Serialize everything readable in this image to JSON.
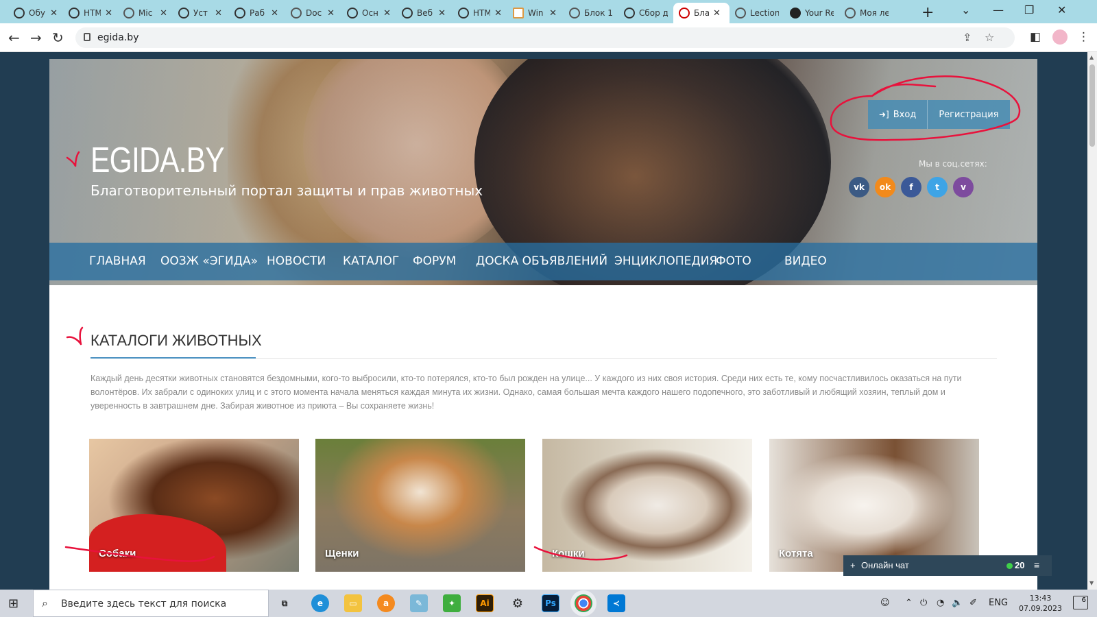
{
  "browser": {
    "tabs": [
      {
        "title": "Обу",
        "icon": "openai-icon"
      },
      {
        "title": "HTM",
        "icon": "openai-icon"
      },
      {
        "title": "Mic",
        "icon": "globe-icon"
      },
      {
        "title": "Уст",
        "icon": "openai-icon"
      },
      {
        "title": "Раб",
        "icon": "openai-icon"
      },
      {
        "title": "Doc",
        "icon": "globe-icon"
      },
      {
        "title": "Осн",
        "icon": "openai-icon"
      },
      {
        "title": "Веб",
        "icon": "openai-icon"
      },
      {
        "title": "HTM",
        "icon": "openai-icon"
      },
      {
        "title": "Win",
        "icon": "doc-icon"
      },
      {
        "title": "Блок 1.",
        "icon": "globe-icon"
      },
      {
        "title": "Сбор д",
        "icon": "openai-icon"
      },
      {
        "title": "Благ",
        "icon": "paw-icon",
        "active": true
      },
      {
        "title": "Lection",
        "icon": "globe-icon"
      },
      {
        "title": "Your Re",
        "icon": "github-icon"
      },
      {
        "title": "Моя ле",
        "icon": "globe-icon"
      }
    ],
    "url": "egida.by"
  },
  "site": {
    "logo": "EGIDA.BY",
    "tagline": "Благотворительный портал защиты и прав животных",
    "auth": {
      "login": "Вход",
      "register": "Регистрация"
    },
    "social_label": "Мы в соц.сетях:",
    "social": [
      {
        "name": "vk",
        "glyph": "vk",
        "color": "#3b5a84"
      },
      {
        "name": "odnoklassniki",
        "glyph": "ok",
        "color": "#f28a1b"
      },
      {
        "name": "facebook",
        "glyph": "f",
        "color": "#3b5998"
      },
      {
        "name": "twitter",
        "glyph": "t",
        "color": "#3ea4e6"
      },
      {
        "name": "viber",
        "glyph": "v",
        "color": "#7d4b9e"
      }
    ],
    "nav": [
      "ГЛАВНАЯ",
      "ООЗЖ «ЭГИДА»",
      "НОВОСТИ",
      "КАТАЛОГ",
      "ФОРУМ",
      "ДОСКА ОБЪЯВЛЕНИЙ",
      "ЭНЦИКЛОПЕДИЯ",
      "ФОТО",
      "ВИДЕО"
    ],
    "section_title": "КАТАЛОГИ ЖИВОТНЫХ",
    "intro": "Каждый день десятки животных становятся бездомными, кого-то выбросили, кто-то потерялся, кто-то был рожден на улице... У каждого из них своя история. Среди них есть те, кому посчастливилось оказаться на пути волонтёров. Их забрали с одиноких улиц и с этого момента начала меняться каждая минута их жизни. Однако, самая большая мечта каждого нашего подопечного, это заботливый и любящий хозяин, теплый дом и уверенность в завтрашнем дне. Забирая животное из приюта – Вы сохраняете жизнь!",
    "catalogs": [
      {
        "label": "Собаки"
      },
      {
        "label": "Щенки"
      },
      {
        "label": "Кошки"
      },
      {
        "label": "Котята"
      }
    ],
    "chat": {
      "plus": "+",
      "label": "Онлайн чат",
      "count": "20"
    }
  },
  "taskbar": {
    "search_placeholder": "Введите здесь текст для поиска",
    "apps": [
      "task-view",
      "edge",
      "file-explorer",
      "avast",
      "notepad",
      "evernote",
      "illustrator",
      "settings",
      "photoshop",
      "chrome",
      "vscode"
    ],
    "illustrator_label": "Ai",
    "photoshop_label": "Ps",
    "lang": "ENG",
    "time": "13:43",
    "date": "07.09.2023",
    "notifications": "6"
  },
  "colors": {
    "nav_bar": "#2a6ea0",
    "annotation": "#e8123c",
    "chat_bar": "#2e4759"
  }
}
